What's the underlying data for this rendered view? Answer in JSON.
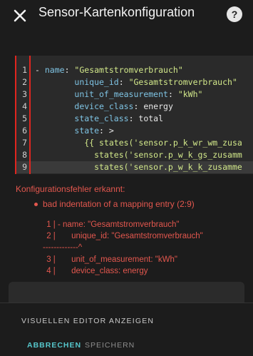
{
  "header": {
    "title": "Sensor-Kartenkonfiguration",
    "close_icon": "close-icon",
    "help_icon": "help-icon",
    "help_glyph": "?"
  },
  "editor": {
    "lines": [
      {
        "n": "1",
        "parts": [
          [
            "k",
            "- "
          ],
          [
            "key",
            "name"
          ],
          [
            "plain",
            ": "
          ],
          [
            "str",
            "\"Gesamtstromverbrauch\""
          ]
        ]
      },
      {
        "n": "2",
        "parts": [
          [
            "plain",
            "        "
          ],
          [
            "key",
            "unique_id"
          ],
          [
            "plain",
            ": "
          ],
          [
            "str",
            "\"Gesamtstromverbrauch\""
          ]
        ]
      },
      {
        "n": "3",
        "parts": [
          [
            "plain",
            "        "
          ],
          [
            "key",
            "unit_of_measurement"
          ],
          [
            "plain",
            ": "
          ],
          [
            "str",
            "\"kWh\""
          ]
        ]
      },
      {
        "n": "4",
        "parts": [
          [
            "plain",
            "        "
          ],
          [
            "key",
            "device_class"
          ],
          [
            "plain",
            ": energy"
          ]
        ]
      },
      {
        "n": "5",
        "parts": [
          [
            "plain",
            "        "
          ],
          [
            "key",
            "state_class"
          ],
          [
            "plain",
            ": total"
          ]
        ]
      },
      {
        "n": "6",
        "parts": [
          [
            "plain",
            "        "
          ],
          [
            "key",
            "state"
          ],
          [
            "plain",
            ": >"
          ]
        ]
      },
      {
        "n": "7",
        "parts": [
          [
            "str",
            "          {{ states('sensor.p_k_wr_wm_zusa"
          ]
        ]
      },
      {
        "n": "8",
        "parts": [
          [
            "str",
            "            states('sensor.p_w_k_gs_zusamm"
          ]
        ]
      },
      {
        "n": "9",
        "parts": [
          [
            "str",
            "            states('sensor.p_w_k_k_zusamme"
          ]
        ]
      }
    ],
    "active_line": "9"
  },
  "errors": {
    "title": "Konfigurationsfehler erkannt:",
    "message": "bad indentation of a mapping entry (2:9)",
    "snippet": [
      " 1 | - name: \"Gesamtstromverbrauch\"",
      " 2 |       unique_id: \"Gesamtstromverbrauch\"",
      "-------------^",
      " 3 |       unit_of_measurement: \"kWh\"",
      " 4 |       device_class: energy"
    ]
  },
  "footer": {
    "visual_editor_label": "VISUELLEN EDITOR ANZEIGEN",
    "cancel_label": "ABBRECHEN",
    "save_label": "SPEICHERN"
  },
  "colors": {
    "accent": "#56c7cc",
    "error": "#e3574e",
    "background": "#1c1c1c"
  }
}
